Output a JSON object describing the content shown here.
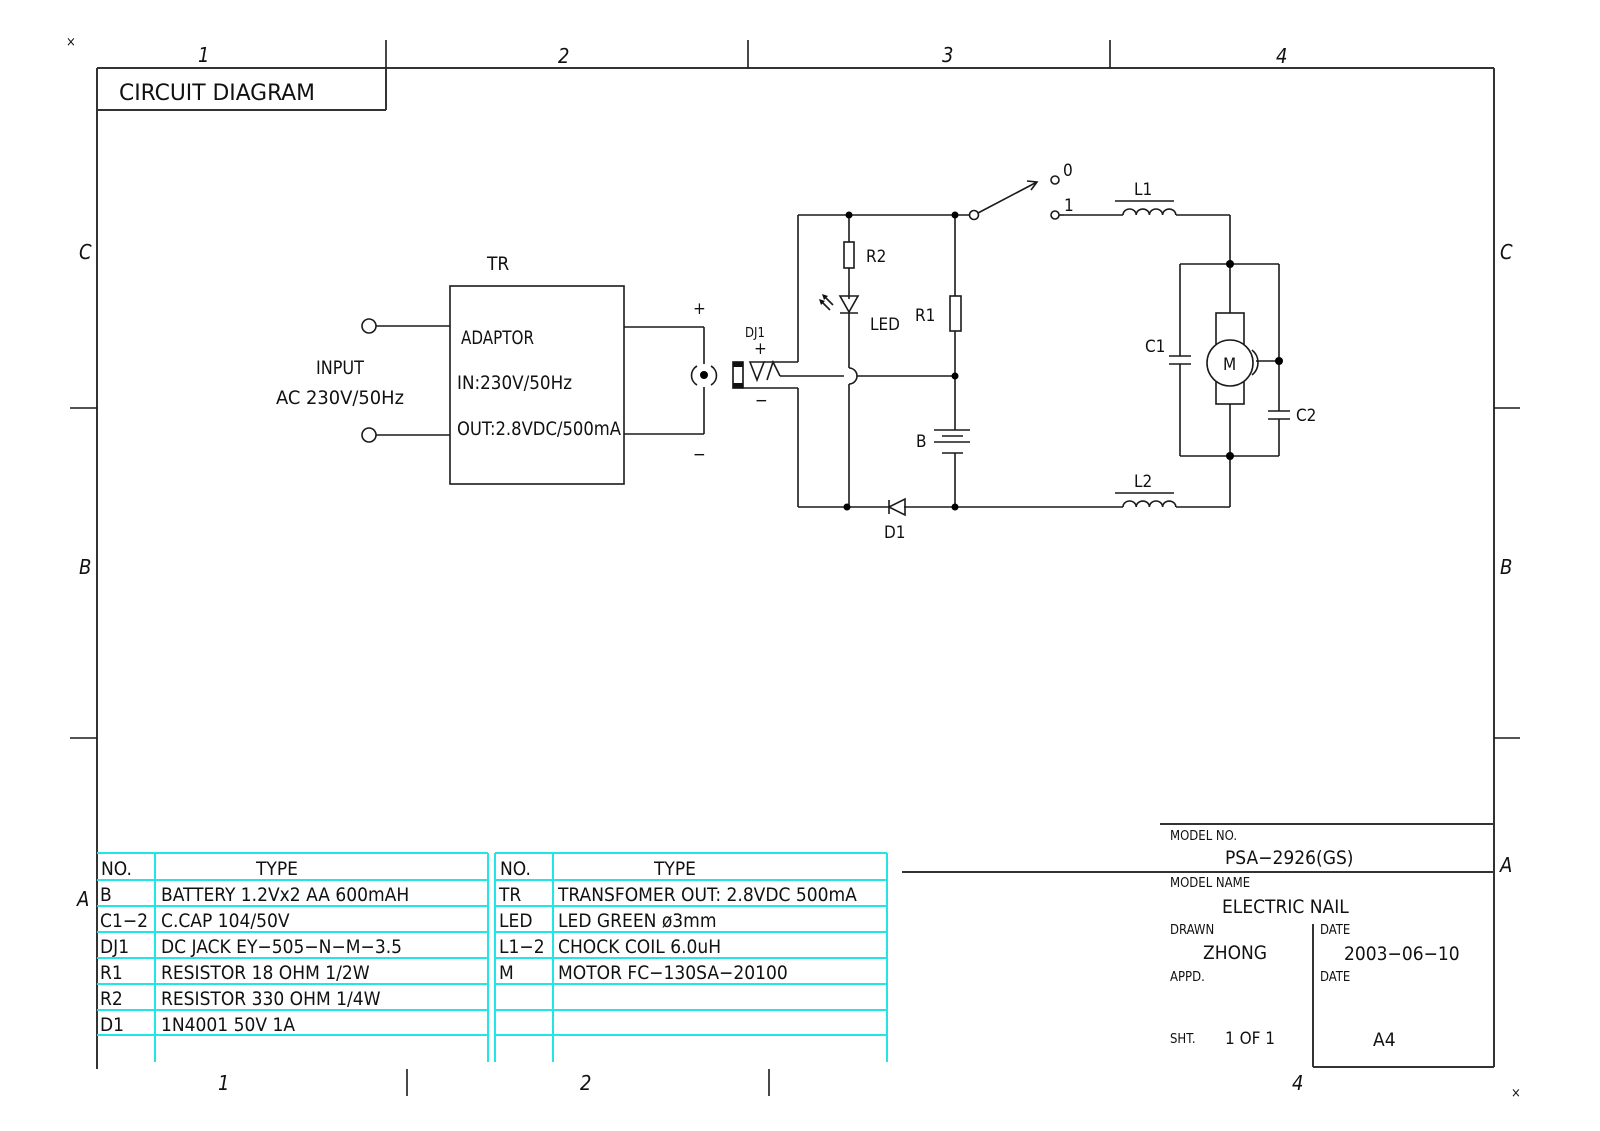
{
  "title": "CIRCUIT DIAGRAM",
  "zones": {
    "columns": [
      "1",
      "2",
      "3",
      "4"
    ],
    "rows": [
      "C",
      "B",
      "A"
    ]
  },
  "schematic": {
    "adaptor": {
      "ref": "TR",
      "name": "ADAPTOR",
      "input_spec": "IN:230V/50Hz",
      "output_spec": "OUT:2.8VDC/500mA",
      "plus": "+",
      "minus": "−"
    },
    "input_label": "INPUT",
    "input_spec": "AC  230V/50Hz",
    "dc_jack": {
      "ref": "DJ1",
      "plus": "+",
      "minus": "−"
    },
    "components": {
      "r2": "R2",
      "led": "LED",
      "r1": "R1",
      "battery": "B",
      "d1": "D1",
      "l1": "L1",
      "l2": "L2",
      "c1": "C1",
      "c2": "C2",
      "motor": "M"
    },
    "switch": {
      "pos0": "0",
      "pos1": "1"
    }
  },
  "parts_table_left": {
    "headers": [
      "NO.",
      "TYPE"
    ],
    "rows": [
      [
        "B",
        "BATTERY  1.2Vx2  AA    600mAH"
      ],
      [
        "C1−2",
        "C.CAP  104/50V"
      ],
      [
        "DJ1",
        "DC  JACK  EY−505−N−M−3.5"
      ],
      [
        "R1",
        "RESISTOR  18  OHM  1/2W"
      ],
      [
        "R2",
        "RESISTOR  330  OHM    1/4W"
      ],
      [
        "D1",
        "1N4001  50V  1A"
      ],
      [
        "",
        ""
      ]
    ]
  },
  "parts_table_right": {
    "headers": [
      "NO.",
      "TYPE"
    ],
    "rows": [
      [
        "TR",
        "TRANSFOMER  OUT:  2.8VDC  500mA"
      ],
      [
        "LED",
        "LED  GREEN  ø3mm"
      ],
      [
        "L1−2",
        "CHOCK  COIL  6.0uH"
      ],
      [
        "M",
        "MOTOR  FC−130SA−20100"
      ],
      [
        "",
        ""
      ],
      [
        "",
        ""
      ],
      [
        "",
        ""
      ]
    ]
  },
  "title_block": {
    "model_no_label": "MODEL  NO.",
    "model_no": "PSA−2926(GS)",
    "model_name_label": "MODEL  NAME",
    "model_name": "ELECTRIC  NAIL",
    "drawn_label": "DRAWN",
    "drawn": "ZHONG",
    "date_label": "DATE",
    "date": "2003−06−10",
    "appd_label": "APPD.",
    "appd_date_label": "DATE",
    "sheet_label": "SHT.",
    "sheet": "1  OF  1",
    "size": "A4"
  },
  "corner_marks": [
    "×",
    "×"
  ],
  "colors": {
    "line": "#1a1a1a",
    "table_grid": "#22e5e5",
    "background": "#ffffff"
  }
}
